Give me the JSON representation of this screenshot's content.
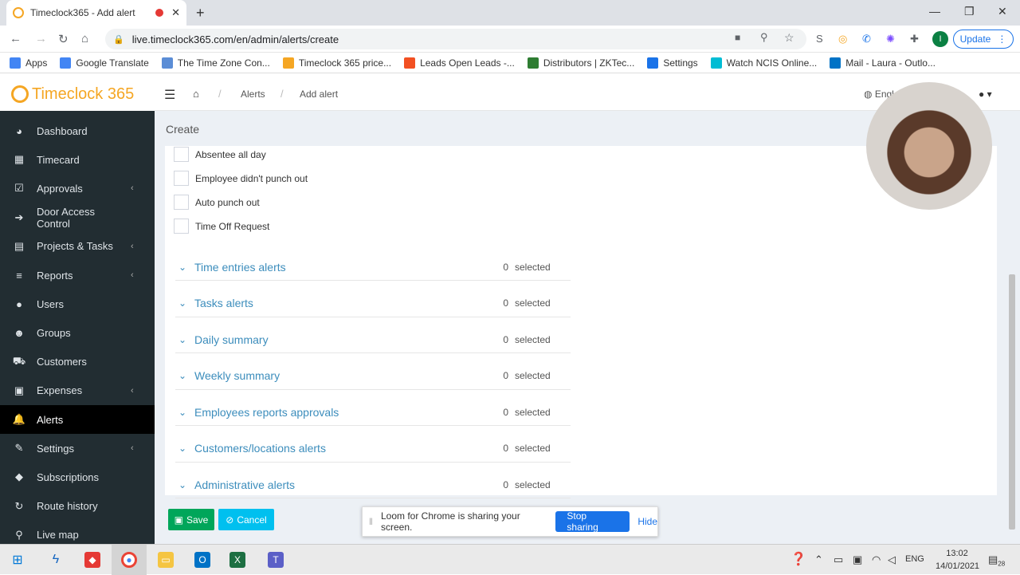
{
  "browser": {
    "tab_title": "Timeclock365 - Add alert",
    "new_tab": "+",
    "url": "live.timeclock365.com/en/admin/alerts/create",
    "update_label": "Update",
    "profile_initial": "I",
    "bookmarks": [
      {
        "label": "Apps",
        "color": "#4285f4"
      },
      {
        "label": "Google Translate",
        "color": "#4285f4"
      },
      {
        "label": "The Time Zone Con...",
        "color": "#5b8dd6"
      },
      {
        "label": "Timeclock 365 price...",
        "color": "#f5a623"
      },
      {
        "label": "Leads Open Leads -...",
        "color": "#f25022"
      },
      {
        "label": "Distributors | ZKTec...",
        "color": "#2e7d32"
      },
      {
        "label": "Settings",
        "color": "#1a73e8"
      },
      {
        "label": "Watch NCIS Online...",
        "color": "#00bcd4"
      },
      {
        "label": "Mail - Laura - Outlo...",
        "color": "#0072c6"
      }
    ]
  },
  "app": {
    "logo": "Timeclock 365",
    "breadcrumb": [
      "Alerts",
      "Add alert"
    ],
    "language": "Engl",
    "page_title": "Create"
  },
  "sidebar": [
    {
      "label": "Dashboard",
      "icon": "dashboard-icon",
      "glyph": "◕",
      "chev": false,
      "active": false
    },
    {
      "label": "Timecard",
      "icon": "calendar-icon",
      "glyph": "▦",
      "chev": false,
      "active": false
    },
    {
      "label": "Approvals",
      "icon": "check-square-icon",
      "glyph": "☑",
      "chev": true,
      "active": false
    },
    {
      "label": "Door Access Control",
      "icon": "sign-in-icon",
      "glyph": "➔",
      "chev": false,
      "active": false
    },
    {
      "label": "Projects & Tasks",
      "icon": "tasks-icon",
      "glyph": "▤",
      "chev": true,
      "active": false
    },
    {
      "label": "Reports",
      "icon": "bars-icon",
      "glyph": "≡",
      "chev": true,
      "active": false
    },
    {
      "label": "Users",
      "icon": "user-icon",
      "glyph": "●",
      "chev": false,
      "active": false
    },
    {
      "label": "Groups",
      "icon": "users-icon",
      "glyph": "☻",
      "chev": false,
      "active": false
    },
    {
      "label": "Customers",
      "icon": "cart-icon",
      "glyph": "⛟",
      "chev": false,
      "active": false
    },
    {
      "label": "Expenses",
      "icon": "money-icon",
      "glyph": "▣",
      "chev": true,
      "active": false
    },
    {
      "label": "Alerts",
      "icon": "bell-icon",
      "glyph": "🔔",
      "chev": false,
      "active": true
    },
    {
      "label": "Settings",
      "icon": "wrench-icon",
      "glyph": "✎",
      "chev": true,
      "active": false
    },
    {
      "label": "Subscriptions",
      "icon": "tags-icon",
      "glyph": "◆",
      "chev": false,
      "active": false
    },
    {
      "label": "Route history",
      "icon": "history-icon",
      "glyph": "↻",
      "chev": false,
      "active": false
    },
    {
      "label": "Live map",
      "icon": "map-marker-icon",
      "glyph": "⚲",
      "chev": false,
      "active": false
    }
  ],
  "checkboxes": [
    "Absentee all day",
    "Employee didn't punch out",
    "Auto punch out",
    "Time Off Request"
  ],
  "sections": [
    {
      "title": "Time entries alerts",
      "count": "0",
      "suffix": "selected"
    },
    {
      "title": "Tasks alerts",
      "count": "0",
      "suffix": "selected"
    },
    {
      "title": "Daily summary",
      "count": "0",
      "suffix": "selected"
    },
    {
      "title": "Weekly summary",
      "count": "0",
      "suffix": "selected"
    },
    {
      "title": "Employees reports approvals",
      "count": "0",
      "suffix": "selected"
    },
    {
      "title": "Customers/locations alerts",
      "count": "0",
      "suffix": "selected"
    },
    {
      "title": "Administrative alerts",
      "count": "0",
      "suffix": "selected"
    }
  ],
  "buttons": {
    "save": "Save",
    "cancel": "Cancel"
  },
  "loom": {
    "message": "Loom for Chrome is sharing your screen.",
    "stop": "Stop sharing",
    "hide": "Hide"
  },
  "taskbar": {
    "lang": "ENG",
    "time": "13:02",
    "date": "14/01/2021",
    "notifications": "28"
  },
  "colors": {
    "link": "#3c8dbc",
    "save": "#00a65a",
    "cancel": "#00c0ef",
    "sidebar": "#222d32"
  }
}
